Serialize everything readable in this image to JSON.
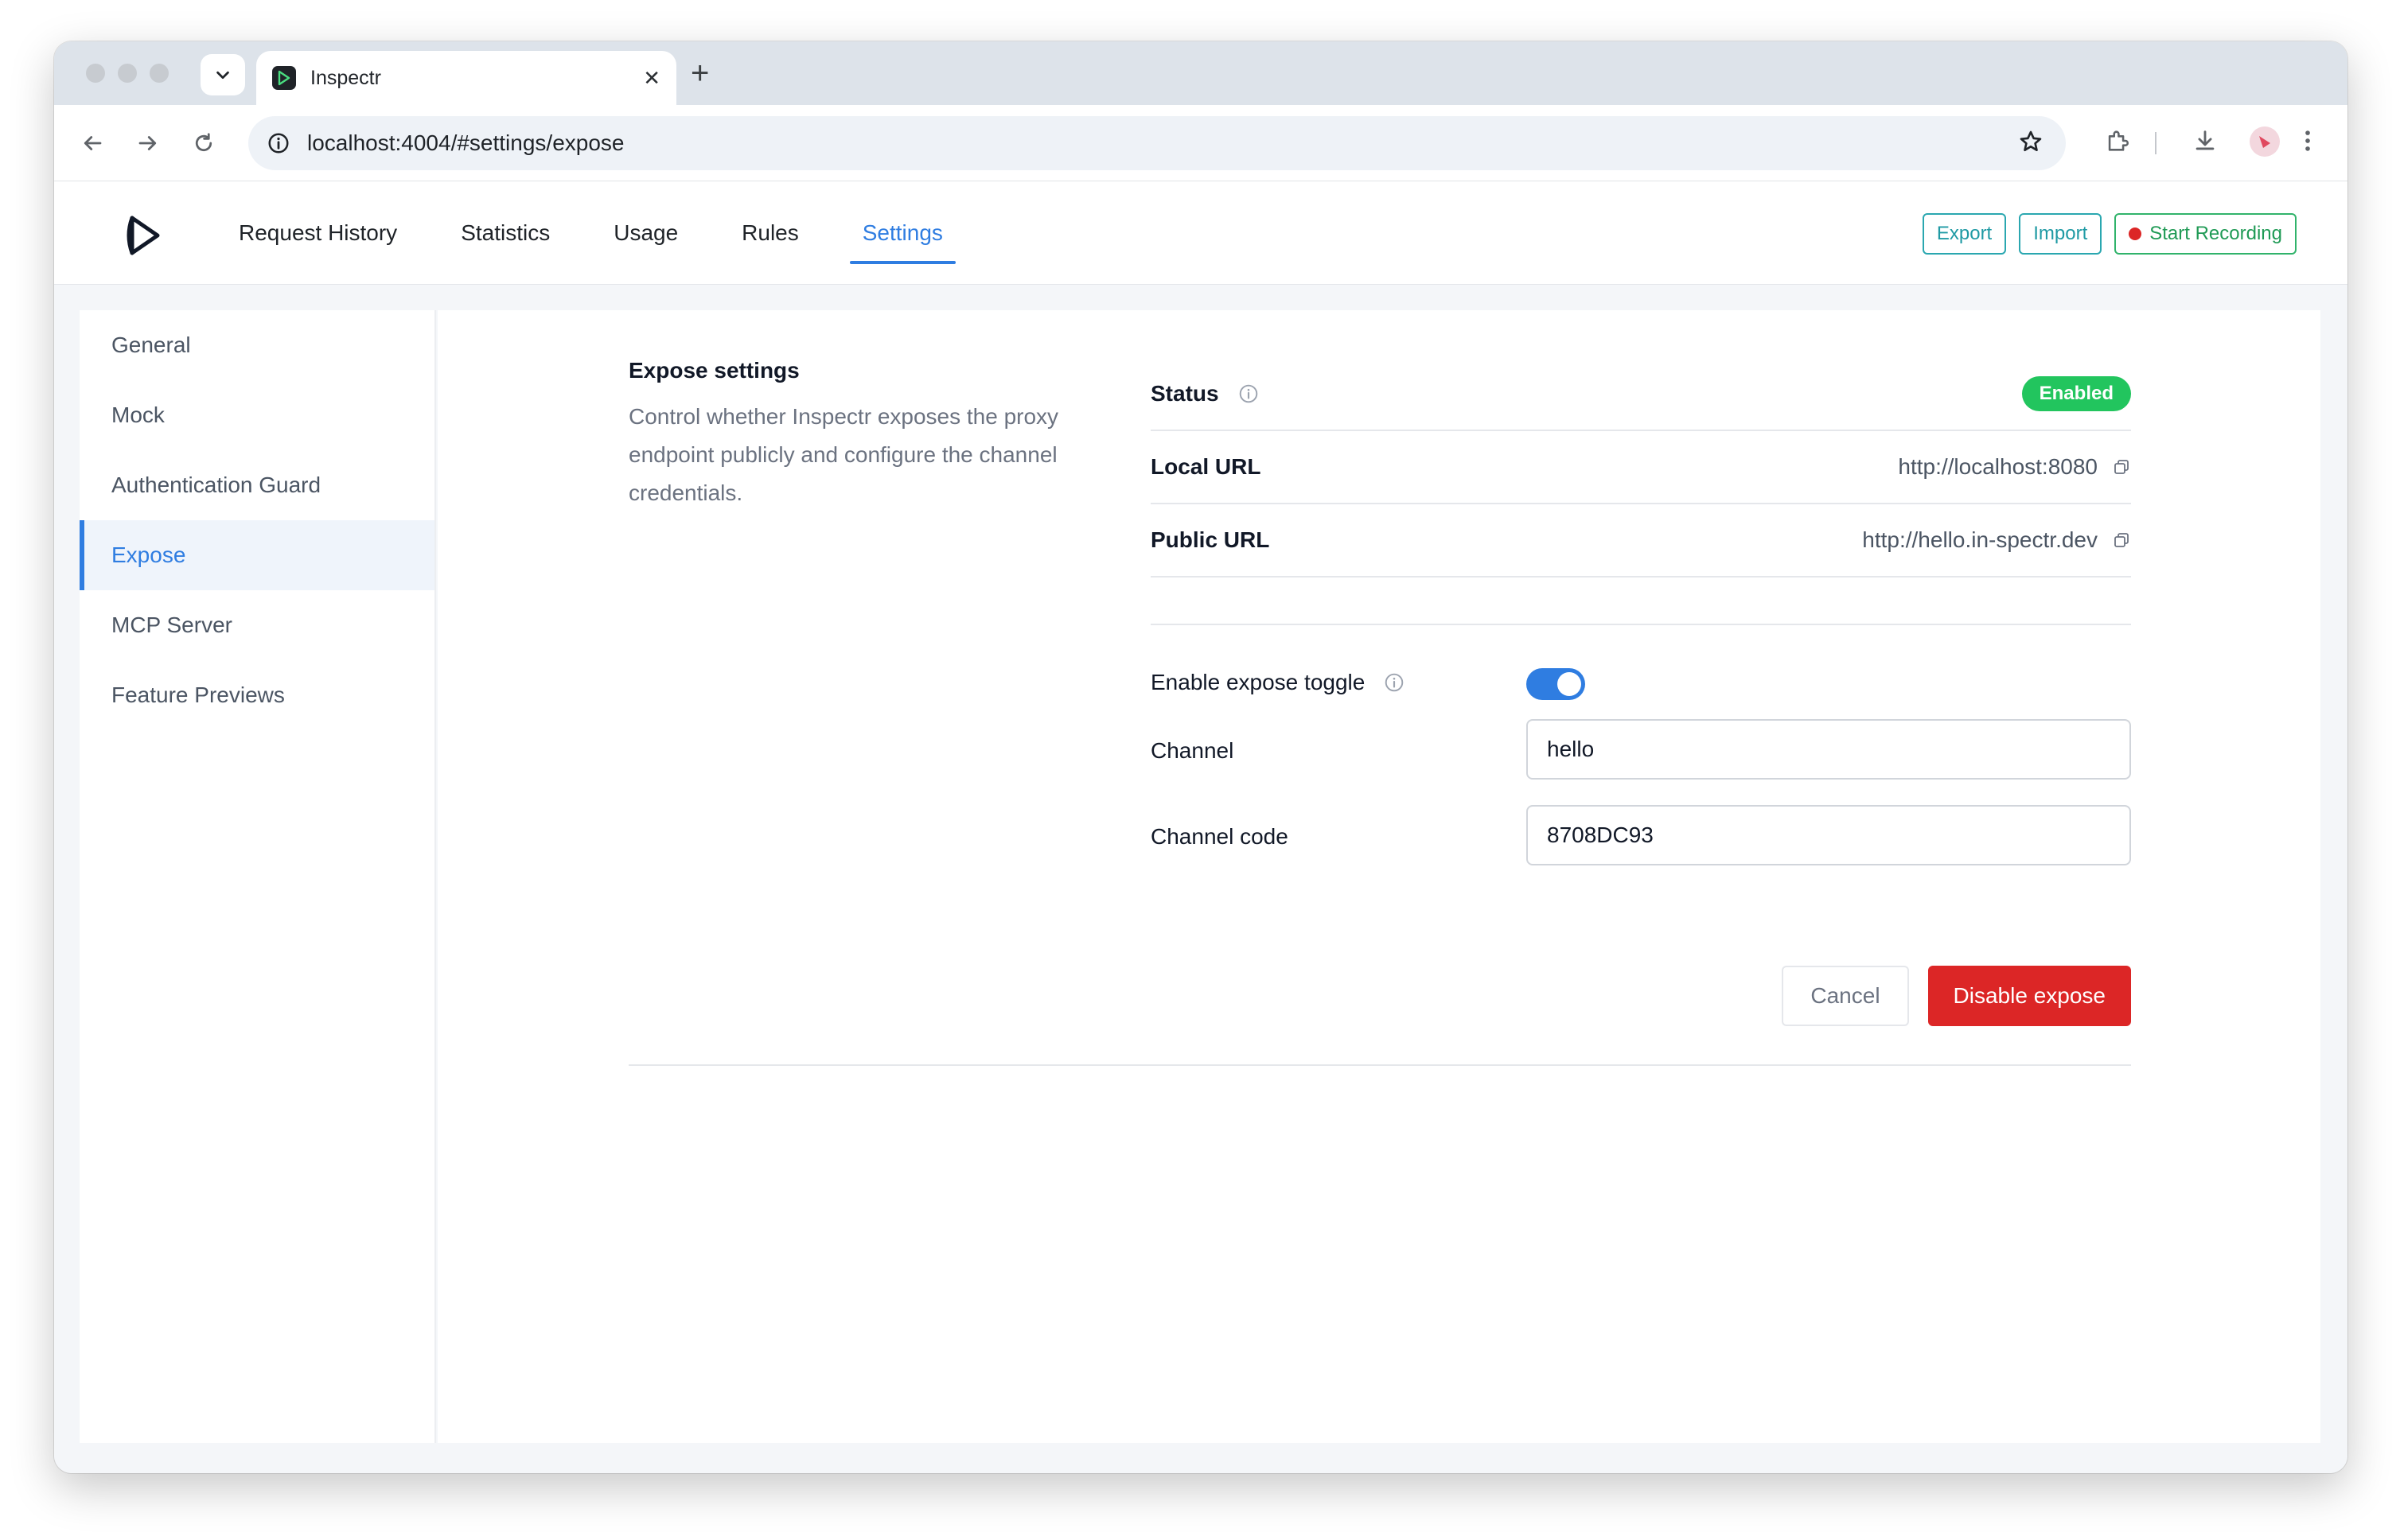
{
  "browser": {
    "tab_title": "Inspectr",
    "url": "localhost:4004/#settings/expose",
    "new_tab": "+",
    "close_tab": "✕"
  },
  "app": {
    "nav": [
      {
        "label": "Request History"
      },
      {
        "label": "Statistics"
      },
      {
        "label": "Usage"
      },
      {
        "label": "Rules"
      },
      {
        "label": "Settings",
        "active": true
      }
    ],
    "header_buttons": {
      "export": "Export",
      "import": "Import",
      "record": "Start Recording"
    }
  },
  "sidebar": {
    "items": [
      {
        "label": "General"
      },
      {
        "label": "Mock"
      },
      {
        "label": "Authentication Guard"
      },
      {
        "label": "Expose",
        "active": true
      },
      {
        "label": "MCP Server"
      },
      {
        "label": "Feature Previews"
      }
    ]
  },
  "expose": {
    "title": "Expose settings",
    "description": "Control whether Inspectr exposes the proxy endpoint publicly and configure the channel credentials.",
    "status_label": "Status",
    "status_value": "Enabled",
    "local_url_label": "Local URL",
    "local_url_value": "http://localhost:8080",
    "public_url_label": "Public URL",
    "public_url_value": "http://hello.in-spectr.dev",
    "toggle_label": "Enable expose toggle",
    "toggle_on": true,
    "channel_label": "Channel",
    "channel_value": "hello",
    "channel_code_label": "Channel code",
    "channel_code_value": "8708DC93",
    "cancel_label": "Cancel",
    "disable_label": "Disable expose"
  },
  "colors": {
    "accent": "#2f7de1",
    "enabled_badge": "#22c55e",
    "danger": "#dc2626",
    "outline_teal": "#2aa7b0",
    "outline_green": "#31b36b"
  }
}
